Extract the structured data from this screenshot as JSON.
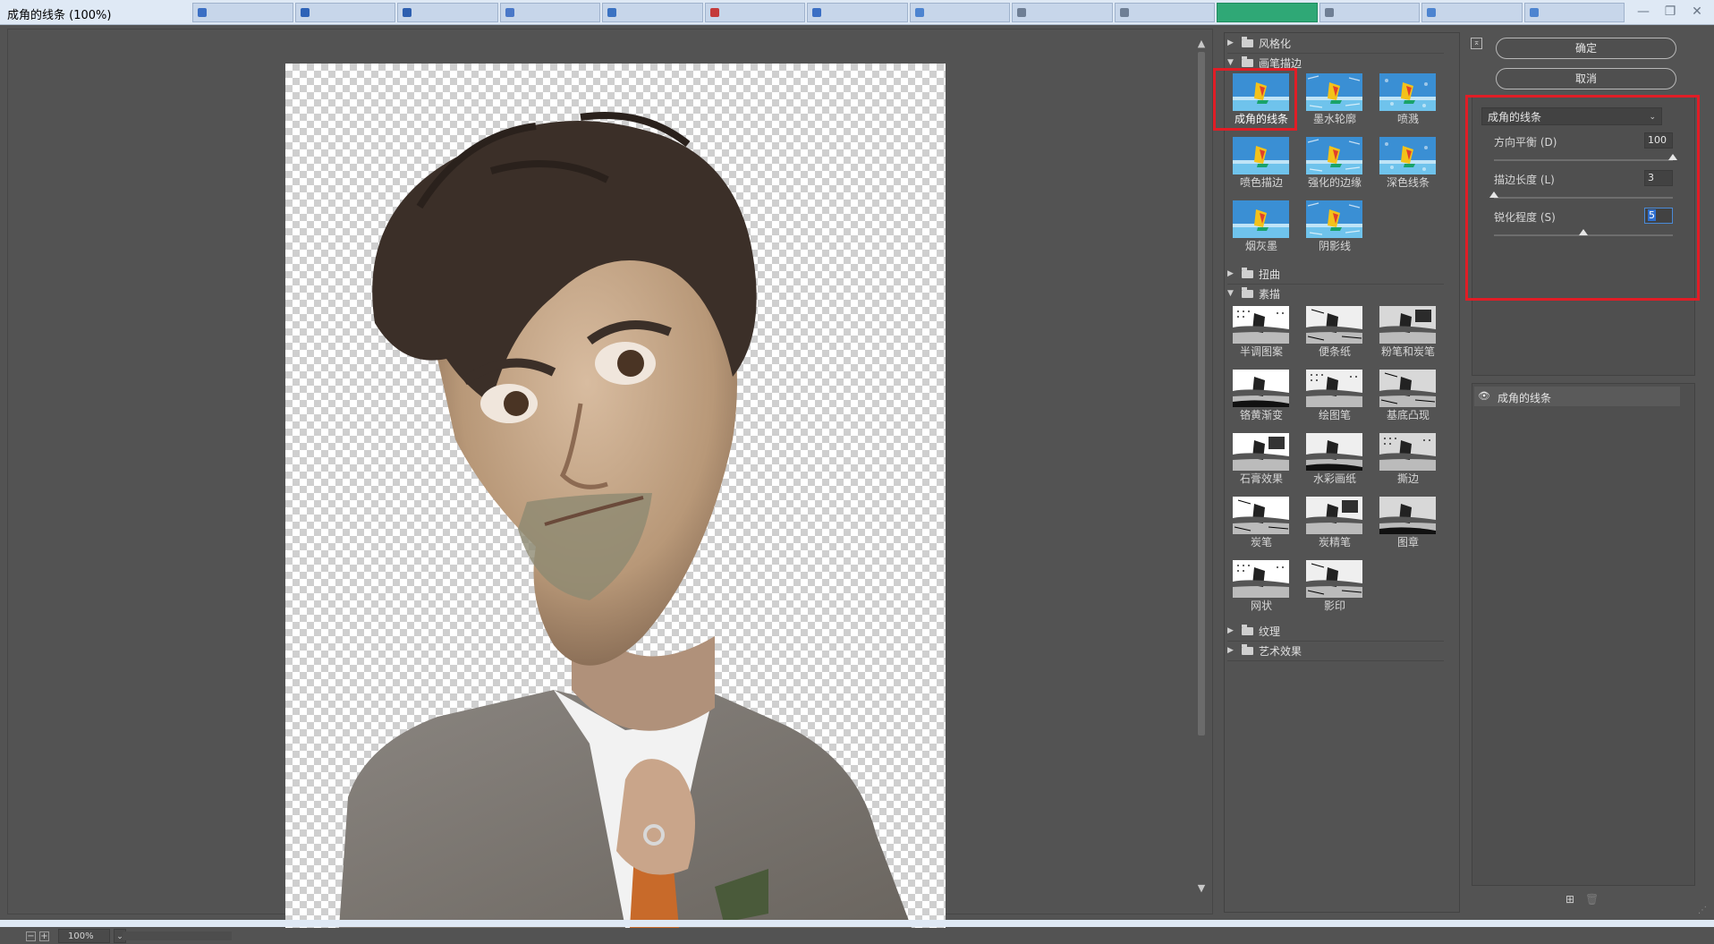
{
  "window": {
    "title": "成角的线条 (100%)",
    "background_tabs": [
      "",
      "",
      "",
      "",
      "",
      "",
      "",
      "",
      "",
      "",
      "",
      "",
      "",
      ""
    ],
    "tab_colors": [
      "#3b6fc4",
      "#2e63b8",
      "#2d5fb0",
      "#4a78c8",
      "#3a72c2",
      "#c43b3b",
      "#3b6fc4",
      "#4d84d0",
      "#6f7f95",
      "#6f7f95",
      "#2fa876",
      "#6f7f95",
      "#4d84d0",
      "#4d84d0"
    ],
    "controls": [
      "—",
      "❐",
      "✕"
    ]
  },
  "preview": {
    "zoom_out_glyph": "−",
    "zoom_in_glyph": "+",
    "zoom_value": "100%",
    "zoom_dropdown_glyph": "⌄",
    "scroll_up": "▲",
    "scroll_down": "▼"
  },
  "gallery": {
    "scroll_up": "▲",
    "scroll_down": "▼",
    "categories": {
      "stylize": {
        "label": "风格化",
        "expanded": false,
        "glyph": "▶"
      },
      "brush_strokes": {
        "label": "画笔描边",
        "expanded": true,
        "glyph": "▼",
        "filters": [
          "成角的线条",
          "墨水轮廓",
          "喷溅",
          "喷色描边",
          "强化的边缘",
          "深色线条",
          "烟灰墨",
          "阴影线"
        ]
      },
      "distort": {
        "label": "扭曲",
        "expanded": false,
        "glyph": "▶"
      },
      "sketch": {
        "label": "素描",
        "expanded": true,
        "glyph": "▼",
        "filters": [
          "半调图案",
          "便条纸",
          "粉笔和炭笔",
          "铬黄渐变",
          "绘图笔",
          "基底凸现",
          "石膏效果",
          "水彩画纸",
          "撕边",
          "炭笔",
          "炭精笔",
          "图章",
          "网状",
          "影印"
        ]
      },
      "texture": {
        "label": "纹理",
        "expanded": false,
        "glyph": "▶"
      },
      "artistic": {
        "label": "艺术效果",
        "expanded": false,
        "glyph": "▶"
      }
    },
    "selected_filter": "成角的线条"
  },
  "actions": {
    "ok": "确定",
    "cancel": "取消",
    "collapse_glyph": "⌅"
  },
  "options": {
    "filter_name": "成角的线条",
    "dropdown_glyph": "⌄",
    "params": [
      {
        "label": "方向平衡 (D)",
        "value": "100",
        "min": 0,
        "max": 100
      },
      {
        "label": "描边长度 (L)",
        "value": "3",
        "min": 3,
        "max": 50
      },
      {
        "label": "锐化程度 (S)",
        "value": "5",
        "min": 0,
        "max": 10
      }
    ]
  },
  "layers": {
    "eye_glyph": "👁",
    "items": [
      {
        "name": "成角的线条",
        "visible": true
      }
    ],
    "new_layer_glyph": "⊞",
    "delete_glyph": "🗑"
  },
  "resize_glyph": "⋰",
  "colors": {
    "panel": "#535353",
    "highlight": "#e01d26",
    "accent": "#2f6fcf"
  }
}
